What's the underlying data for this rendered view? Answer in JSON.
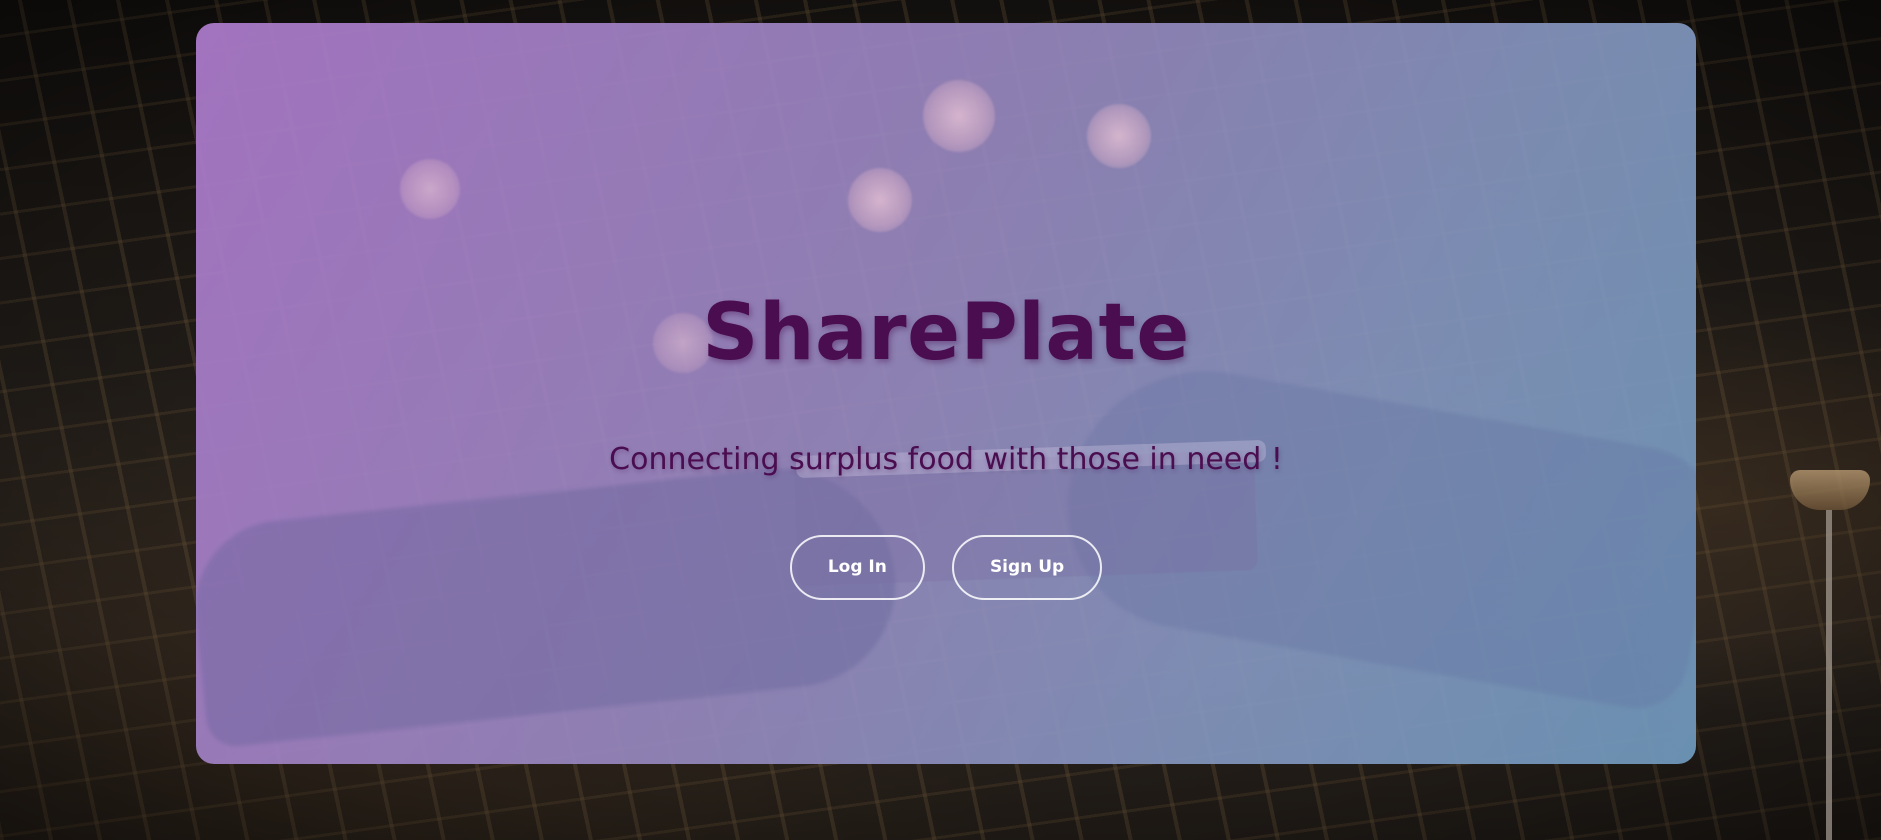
{
  "app": {
    "brand_name": "SharePlate",
    "tagline": "Connecting surplus food with those in need !"
  },
  "actions": {
    "login_label": "Log In",
    "signup_label": "Sign Up"
  },
  "theme": {
    "title_color": "#4a0d4f",
    "button_border_color": "#ffffff",
    "overlay_start": "#aa78c8",
    "overlay_end": "#6e96b9"
  }
}
